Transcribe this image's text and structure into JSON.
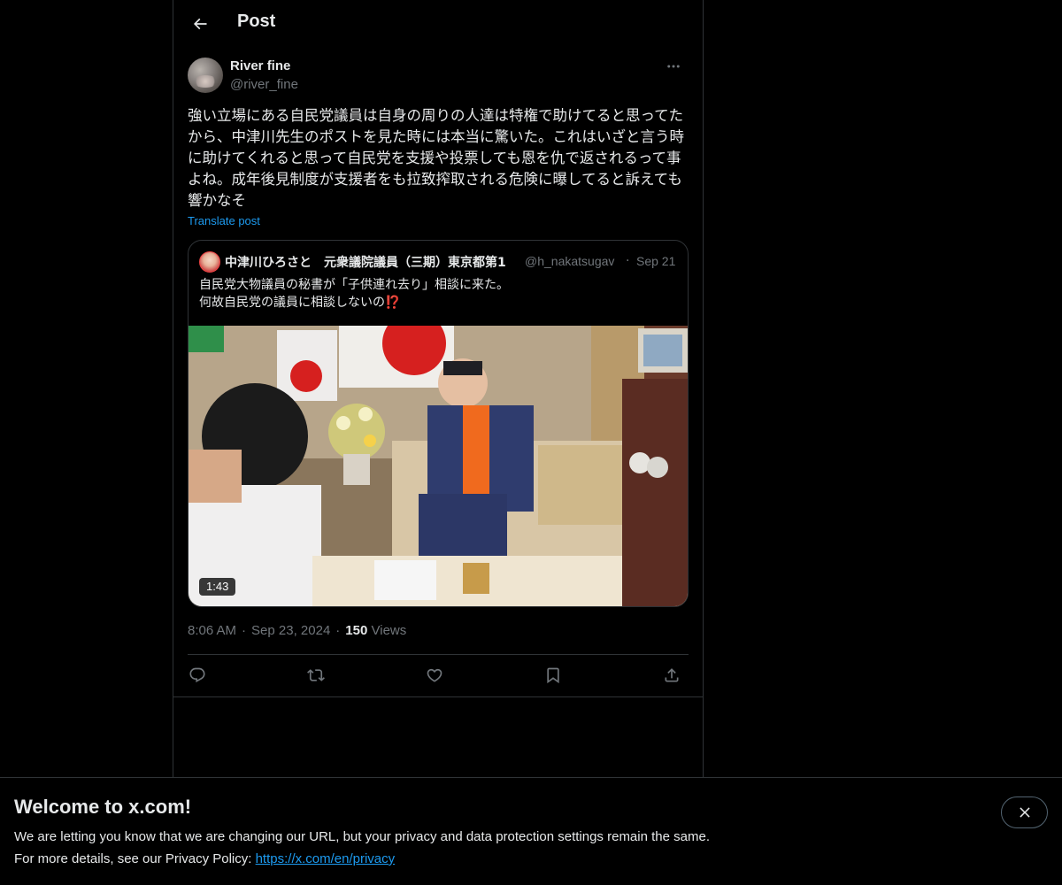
{
  "header": {
    "title": "Post",
    "back_icon": "arrow-left-icon"
  },
  "post": {
    "author_name": "River fine",
    "author_handle": "@river_fine",
    "text": "強い立場にある自民党議員は自身の周りの人達は特権で助けてると思ってたから、中津川先生のポストを見た時には本当に驚いた。これはいざと言う時に助けてくれると思って自民党を支援や投票しても恩を仇で返されるって事よね。成年後見制度が支援者をも拉致搾取される危険に曝してると訴えても響かなそ",
    "translate_label": "Translate post",
    "time": "8:06 AM",
    "date": "Sep 23, 2024",
    "views_count": "150",
    "views_label": "Views"
  },
  "quote": {
    "name": "中津川ひろさと　元衆議院議員（三期）東京都第1",
    "handle": "@h_nakatsugav",
    "date": "Sep 21",
    "text_line1": "自民党大物議員の秘書が「子供連れ去り」相談に来た。",
    "text_line2": "何故自民党の議員に相談しないの",
    "emoji": "⁉️",
    "video_duration": "1:43"
  },
  "actions": [
    "reply-icon",
    "repost-icon",
    "like-icon",
    "bookmark-icon",
    "share-icon"
  ],
  "banner": {
    "title": "Welcome to x.com!",
    "line1": "We are letting you know that we are changing our URL, but your privacy and data protection settings remain the same.",
    "line2_prefix": "For more details, see our Privacy Policy: ",
    "link": "https://x.com/en/privacy"
  },
  "colors": {
    "background": "#000000",
    "text": "#e7e9ea",
    "muted": "#71767b",
    "accent": "#1d9bf0",
    "border": "#2f3336"
  }
}
